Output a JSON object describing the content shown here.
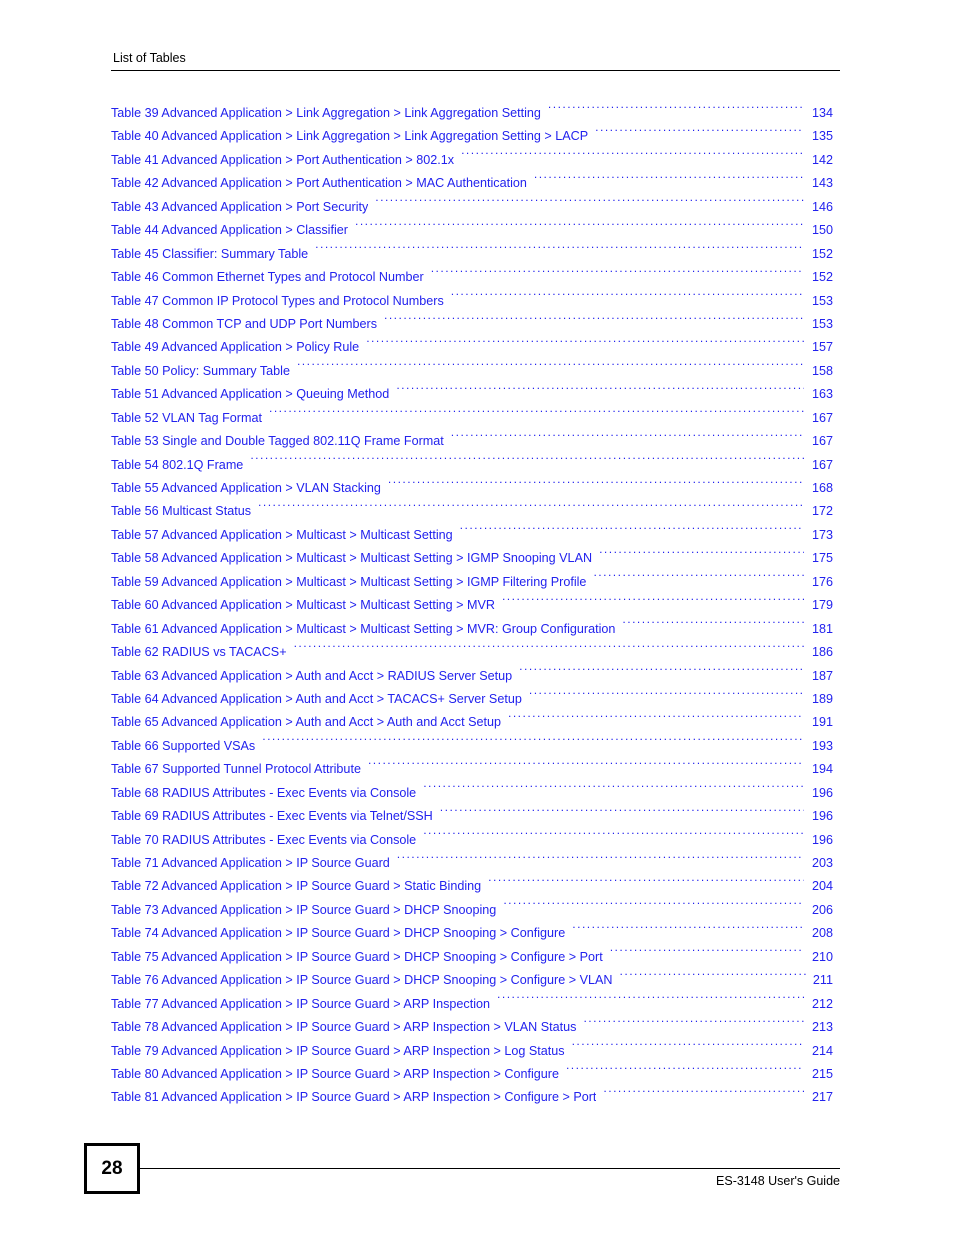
{
  "header": {
    "title": "List of Tables"
  },
  "footer": {
    "page_number": "28",
    "guide_title": "ES-3148 User's Guide"
  },
  "toc": {
    "entries": [
      {
        "label": "Table 39 Advanced Application > Link Aggregation > Link Aggregation Setting",
        "page": "134"
      },
      {
        "label": "Table 40 Advanced Application > Link Aggregation > Link Aggregation Setting > LACP",
        "page": "135"
      },
      {
        "label": "Table 41 Advanced Application > Port Authentication > 802.1x",
        "page": "142"
      },
      {
        "label": "Table 42 Advanced Application > Port Authentication > MAC Authentication",
        "page": "143"
      },
      {
        "label": "Table 43 Advanced Application > Port Security",
        "page": "146"
      },
      {
        "label": "Table 44 Advanced Application > Classifier",
        "page": "150"
      },
      {
        "label": "Table 45 Classifier: Summary Table",
        "page": "152"
      },
      {
        "label": "Table 46 Common Ethernet Types and Protocol Number",
        "page": "152"
      },
      {
        "label": "Table 47 Common IP Protocol Types and Protocol Numbers",
        "page": "153"
      },
      {
        "label": "Table 48 Common TCP and UDP Port Numbers",
        "page": "153"
      },
      {
        "label": "Table 49 Advanced Application > Policy Rule",
        "page": "157"
      },
      {
        "label": "Table 50 Policy: Summary Table",
        "page": "158"
      },
      {
        "label": "Table 51 Advanced Application > Queuing Method",
        "page": "163"
      },
      {
        "label": "Table 52 VLAN Tag Format",
        "page": "167"
      },
      {
        "label": "Table 53 Single and Double Tagged 802.11Q Frame Format",
        "page": "167"
      },
      {
        "label": "Table 54 802.1Q Frame",
        "page": "167"
      },
      {
        "label": "Table 55 Advanced Application > VLAN Stacking",
        "page": "168"
      },
      {
        "label": "Table 56 Multicast Status",
        "page": "172"
      },
      {
        "label": "Table 57 Advanced Application > Multicast > Multicast Setting",
        "page": "173"
      },
      {
        "label": "Table 58 Advanced Application > Multicast > Multicast Setting > IGMP Snooping VLAN",
        "page": "175"
      },
      {
        "label": "Table 59 Advanced Application > Multicast > Multicast Setting > IGMP Filtering Profile",
        "page": "176"
      },
      {
        "label": "Table 60 Advanced Application > Multicast > Multicast Setting > MVR",
        "page": "179"
      },
      {
        "label": "Table 61 Advanced Application > Multicast > Multicast Setting > MVR: Group Configuration",
        "page": "181"
      },
      {
        "label": "Table 62 RADIUS vs TACACS+",
        "page": "186"
      },
      {
        "label": "Table 63 Advanced Application > Auth and Acct > RADIUS Server Setup",
        "page": "187"
      },
      {
        "label": "Table 64 Advanced Application > Auth and Acct > TACACS+ Server Setup",
        "page": "189"
      },
      {
        "label": "Table 65 Advanced Application > Auth and Acct > Auth and Acct Setup",
        "page": "191"
      },
      {
        "label": "Table 66 Supported VSAs",
        "page": "193"
      },
      {
        "label": "Table 67 Supported Tunnel Protocol Attribute",
        "page": "194"
      },
      {
        "label": "Table 68 RADIUS Attributes - Exec Events via Console",
        "page": "196"
      },
      {
        "label": "Table 69 RADIUS Attributes - Exec Events via Telnet/SSH",
        "page": "196"
      },
      {
        "label": "Table 70 RADIUS Attributes - Exec Events via Console",
        "page": "196"
      },
      {
        "label": "Table 71 Advanced Application > IP Source Guard",
        "page": "203"
      },
      {
        "label": "Table 72 Advanced Application > IP Source Guard > Static Binding",
        "page": "204"
      },
      {
        "label": "Table 73 Advanced Application > IP Source Guard > DHCP Snooping",
        "page": "206"
      },
      {
        "label": "Table 74 Advanced Application > IP Source Guard > DHCP Snooping > Configure",
        "page": "208"
      },
      {
        "label": "Table 75 Advanced Application > IP Source Guard > DHCP Snooping > Configure > Port",
        "page": "210"
      },
      {
        "label": "Table 76 Advanced Application > IP Source Guard > DHCP Snooping > Configure > VLAN",
        "page": "211",
        "tight": true
      },
      {
        "label": "Table 77 Advanced Application > IP Source Guard > ARP Inspection",
        "page": "212"
      },
      {
        "label": "Table 78 Advanced Application > IP Source Guard > ARP Inspection > VLAN Status",
        "page": "213"
      },
      {
        "label": "Table 79 Advanced Application > IP Source Guard > ARP Inspection > Log Status",
        "page": "214"
      },
      {
        "label": "Table 80 Advanced Application > IP Source Guard > ARP Inspection > Configure",
        "page": "215"
      },
      {
        "label": "Table 81 Advanced Application > IP Source Guard > ARP Inspection > Configure > Port",
        "page": "217"
      }
    ]
  }
}
